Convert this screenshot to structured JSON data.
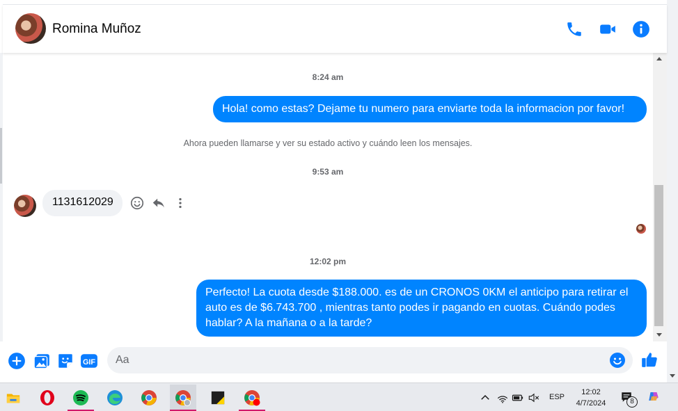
{
  "header": {
    "contact_name": "Romina Muñoz",
    "icons": [
      "phone-icon",
      "video-camera-icon",
      "info-icon"
    ]
  },
  "messages": {
    "time1": "8:24 am",
    "outgoing1": "Hola! como estas? Dejame tu numero para enviarte toda la informacion por favor!",
    "notice": "Ahora pueden llamarse y ver su estado activo y cuándo leen los mensajes.",
    "time2": "9:53 am",
    "incoming1": "1131612029",
    "time3": "12:02 pm",
    "outgoing2_line1": "Perfecto! La cuota desde $188.000. es de un CRONOS 0KM el anticipo para retirar el",
    "outgoing2_line2": "auto es de $6.743.700 , mientras tanto podes ir pagando en cuotas. Cuándo podes",
    "outgoing2_line3": "hablar? A la mañana o a la tarde?"
  },
  "composer": {
    "placeholder": "Aa",
    "gif_label": "GIF",
    "icons": [
      "plus-icon",
      "image-icon",
      "sticker-icon",
      "gif-icon",
      "emoji-icon",
      "thumbs-up-icon"
    ]
  },
  "taskbar": {
    "apps": [
      "file-explorer",
      "opera",
      "spotify",
      "edge",
      "chrome",
      "chrome-profile",
      "sticky-notes",
      "chrome-notification"
    ],
    "language": "ESP",
    "time": "12:02",
    "date": "4/7/2024",
    "notification_count": "8"
  },
  "colors": {
    "accent": "#0084ff",
    "bubble_in": "#f0f2f5",
    "muted_text": "#65676b"
  }
}
